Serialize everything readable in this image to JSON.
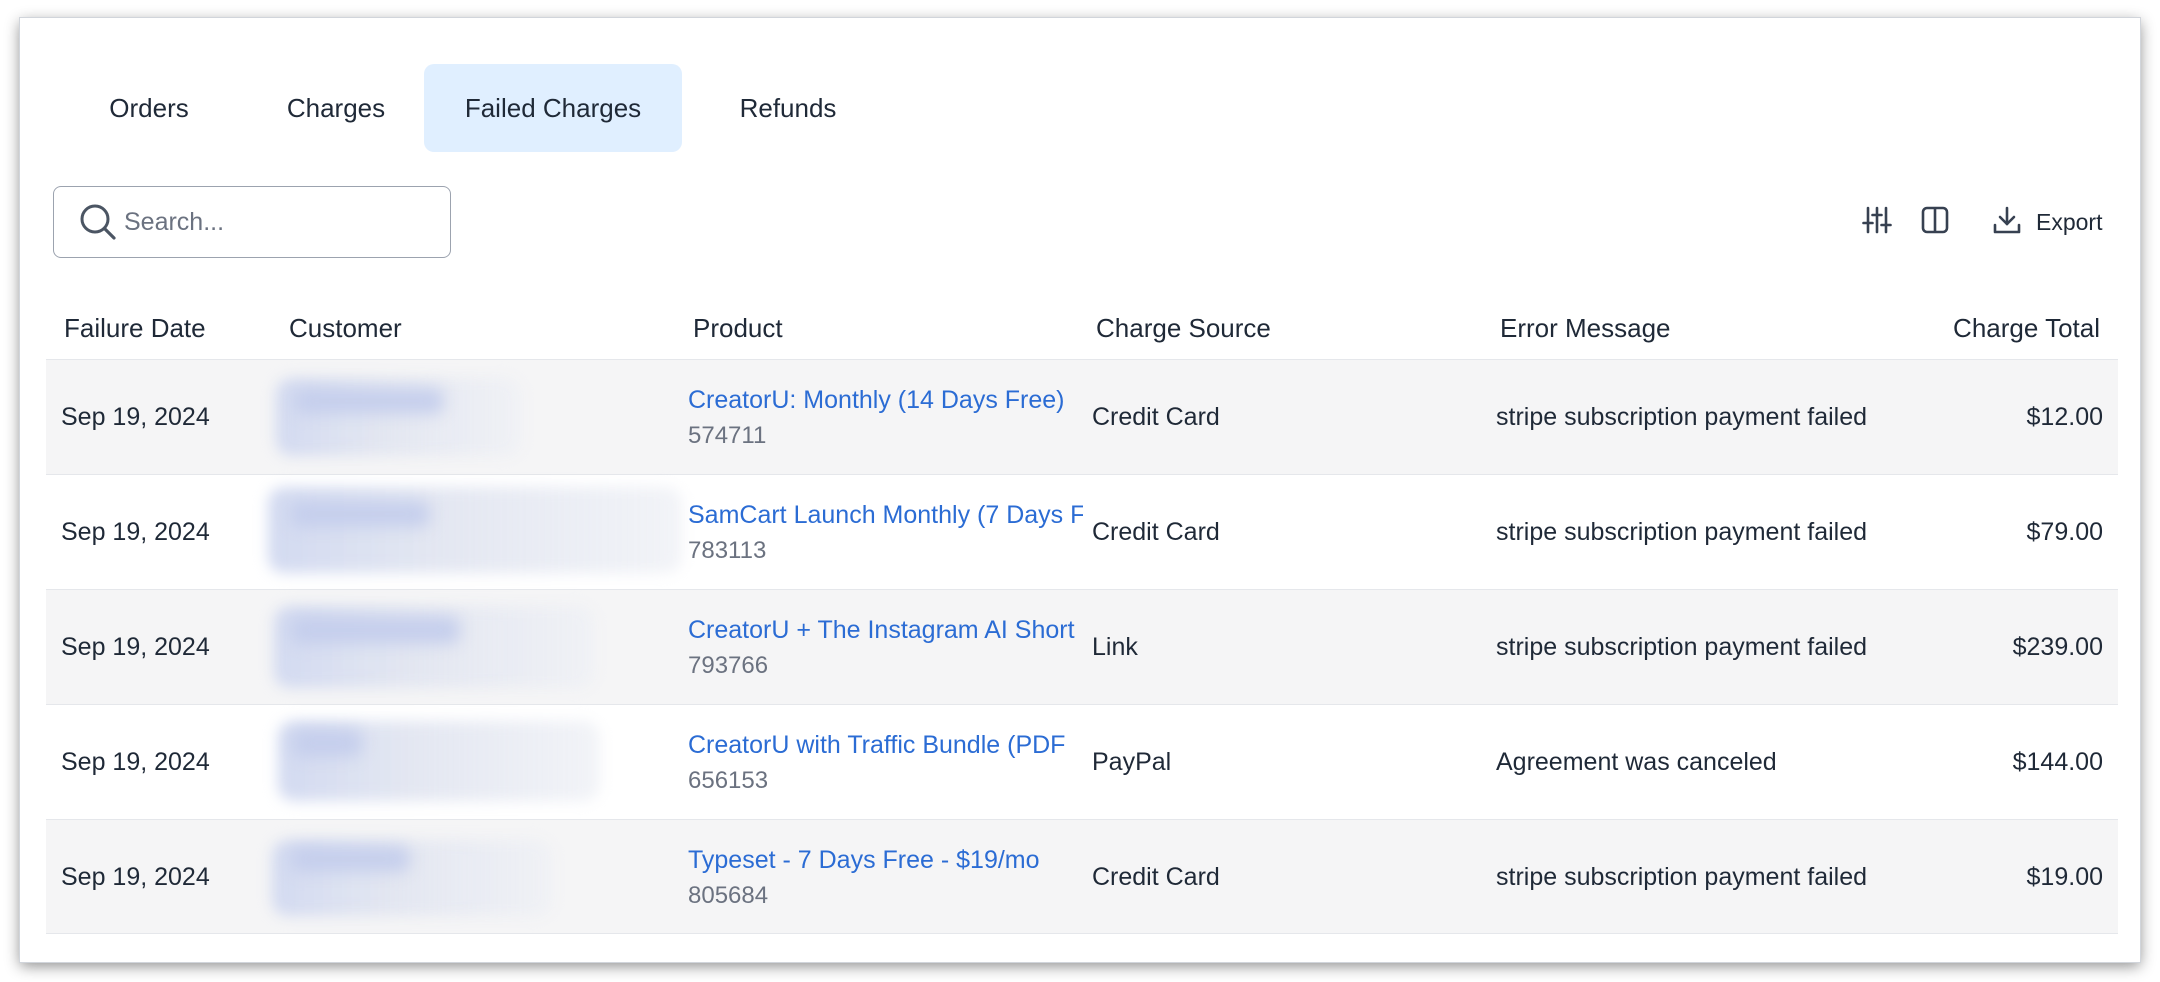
{
  "tabs": [
    {
      "label": "Orders",
      "active": false
    },
    {
      "label": "Charges",
      "active": false
    },
    {
      "label": "Failed Charges",
      "active": true
    },
    {
      "label": "Refunds",
      "active": false
    }
  ],
  "search": {
    "placeholder": "Search...",
    "value": ""
  },
  "toolbar": {
    "filter_icon": "sliders-icon",
    "columns_icon": "columns-icon",
    "export_icon": "download-icon",
    "export_label": "Export"
  },
  "table": {
    "columns": [
      "Failure Date",
      "Customer",
      "Product",
      "Charge Source",
      "Error Message",
      "Charge Total"
    ],
    "rows": [
      {
        "date": "Sep 19, 2024",
        "customer": "",
        "product": "CreatorU: Monthly (14 Days Free)",
        "product_id": "574711",
        "source": "Credit Card",
        "error": "stripe subscription payment failed",
        "total": "$12.00"
      },
      {
        "date": "Sep 19, 2024",
        "customer": "",
        "product": "SamCart Launch Monthly (7 Days F",
        "product_id": "783113",
        "source": "Credit Card",
        "error": "stripe subscription payment failed",
        "total": "$79.00"
      },
      {
        "date": "Sep 19, 2024",
        "customer": "",
        "product": "CreatorU + The Instagram AI Short",
        "product_id": "793766",
        "source": "Link",
        "error": "stripe subscription payment failed",
        "total": "$239.00"
      },
      {
        "date": "Sep 19, 2024",
        "customer": "",
        "product": "CreatorU with Traffic Bundle (PDF",
        "product_id": "656153",
        "source": "PayPal",
        "error": "Agreement was canceled",
        "total": "$144.00"
      },
      {
        "date": "Sep 19, 2024",
        "customer": "",
        "product": "Typeset - 7 Days Free - $19/mo",
        "product_id": "805684",
        "source": "Credit Card",
        "error": "stripe subscription payment failed",
        "total": "$19.00"
      }
    ]
  },
  "colors": {
    "link": "#2b6cd4",
    "active_tab_bg": "#e0efff",
    "row_alt_bg": "#f5f5f6",
    "muted": "#6b7280"
  }
}
